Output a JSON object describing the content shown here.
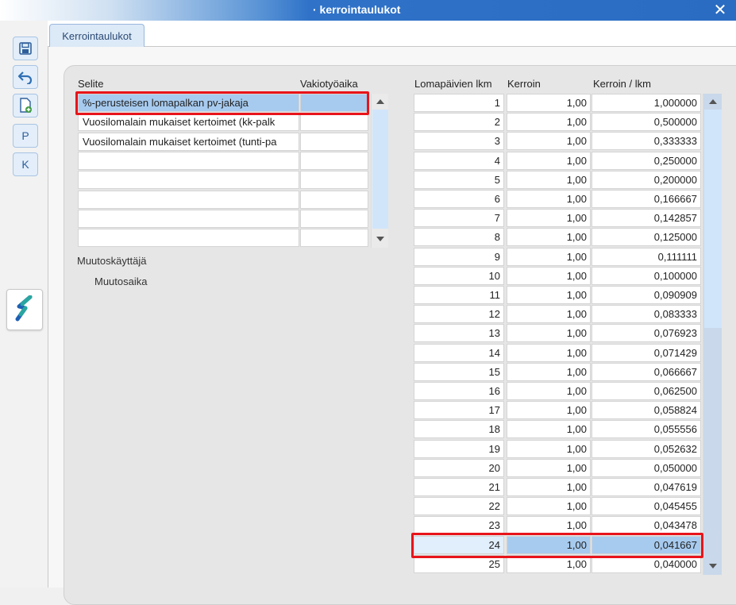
{
  "window": {
    "title": "· kerrointaulukot",
    "close": "✕"
  },
  "toolbar": {
    "buttons": [
      {
        "name": "save-button",
        "icon": "save-icon"
      },
      {
        "name": "undo-button",
        "icon": "undo-icon"
      },
      {
        "name": "new-document-button",
        "icon": "new-document-icon"
      },
      {
        "name": "p-button",
        "label": "P"
      },
      {
        "name": "k-button",
        "label": "K"
      }
    ],
    "logo_icon": "app-logo-icon"
  },
  "tabs": [
    {
      "label": "Kerrointaulukot",
      "active": true
    }
  ],
  "left_table": {
    "headers": [
      "Selite",
      "Vakiotyöaika"
    ],
    "rows": [
      {
        "selite": "%-perusteisen lomapalkan pv-jakaja",
        "vakio": "",
        "selected": true
      },
      {
        "selite": "Vuosilomalain mukaiset kertoimet (kk-palk",
        "vakio": ""
      },
      {
        "selite": "Vuosilomalain mukaiset kertoimet (tunti-pa",
        "vakio": ""
      },
      {
        "selite": "",
        "vakio": ""
      },
      {
        "selite": "",
        "vakio": ""
      },
      {
        "selite": "",
        "vakio": ""
      },
      {
        "selite": "",
        "vakio": ""
      },
      {
        "selite": "",
        "vakio": ""
      }
    ]
  },
  "meta": {
    "muutoskayttaja": "Muutoskäyttäjä",
    "muutosaika": "Muutosaika"
  },
  "right_table": {
    "headers": [
      "Lomapäivien lkm",
      "Kerroin",
      "Kerroin / lkm"
    ],
    "rows": [
      [
        "1",
        "1,00",
        "1,000000"
      ],
      [
        "2",
        "1,00",
        "0,500000"
      ],
      [
        "3",
        "1,00",
        "0,333333"
      ],
      [
        "4",
        "1,00",
        "0,250000"
      ],
      [
        "5",
        "1,00",
        "0,200000"
      ],
      [
        "6",
        "1,00",
        "0,166667"
      ],
      [
        "7",
        "1,00",
        "0,142857"
      ],
      [
        "8",
        "1,00",
        "0,125000"
      ],
      [
        "9",
        "1,00",
        "0,111111"
      ],
      [
        "10",
        "1,00",
        "0,100000"
      ],
      [
        "11",
        "1,00",
        "0,090909"
      ],
      [
        "12",
        "1,00",
        "0,083333"
      ],
      [
        "13",
        "1,00",
        "0,076923"
      ],
      [
        "14",
        "1,00",
        "0,071429"
      ],
      [
        "15",
        "1,00",
        "0,066667"
      ],
      [
        "16",
        "1,00",
        "0,062500"
      ],
      [
        "17",
        "1,00",
        "0,058824"
      ],
      [
        "18",
        "1,00",
        "0,055556"
      ],
      [
        "19",
        "1,00",
        "0,052632"
      ],
      [
        "20",
        "1,00",
        "0,050000"
      ],
      [
        "21",
        "1,00",
        "0,047619"
      ],
      [
        "22",
        "1,00",
        "0,045455"
      ],
      [
        "23",
        "1,00",
        "0,043478"
      ],
      [
        "24",
        "1,00",
        "0,041667"
      ],
      [
        "25",
        "1,00",
        "0,040000"
      ]
    ],
    "selected_row": 23
  },
  "colors": {
    "highlight": "#e8141a",
    "selection": "#a7cbef",
    "titlebar": "#2f72c8"
  }
}
